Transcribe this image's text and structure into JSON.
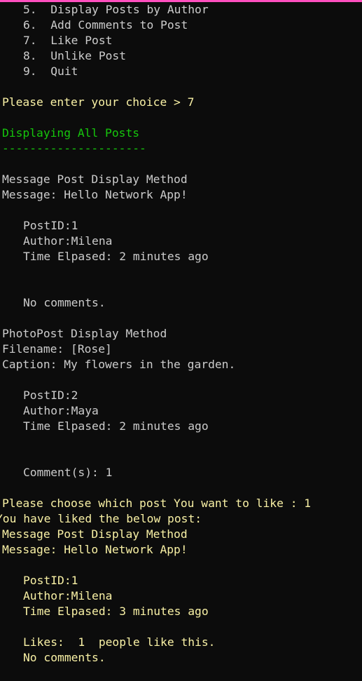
{
  "window": {
    "border_color": "#ff4fbf",
    "background": "#0c0c0c"
  },
  "colors": {
    "default_text": "#cccccc",
    "prompt_text": "#f9f1a5",
    "heading_text": "#16c60c"
  },
  "menu": {
    "items": [
      "5.  Display Posts by Author",
      "6.  Add Comments to Post",
      "7.  Like Post",
      "8.  Unlike Post",
      "9.  Quit"
    ]
  },
  "prompt": {
    "choice_line": "Please enter your choice > 7"
  },
  "section": {
    "title": "Displaying All Posts",
    "underline": "---------------------"
  },
  "posts": [
    {
      "header": "Message Post Display Method",
      "message_line": "Message: Hello Network App!",
      "post_id": "PostID:1",
      "author": "Author:Milena",
      "time_elapsed": "Time Elpased: 2 minutes ago",
      "comments": "No comments."
    },
    {
      "header": "PhotoPost Display Method",
      "filename_line": "Filename: [Rose]",
      "caption_line": "Caption: My flowers in the garden.",
      "post_id": "PostID:2",
      "author": "Author:Maya",
      "time_elapsed": "Time Elpased: 2 minutes ago",
      "comments": "Comment(s): 1"
    }
  ],
  "like": {
    "prompt_line": "Please choose which post You want to like : 1",
    "confirm_line": "You have liked the below post:",
    "header": "Message Post Display Method",
    "message_line": "Message: Hello Network App!",
    "post_id": "PostID:1",
    "author": "Author:Milena",
    "time_elapsed": "Time Elpased: 3 minutes ago",
    "likes_line": "Likes:  1  people like this.",
    "comments": "No comments."
  }
}
